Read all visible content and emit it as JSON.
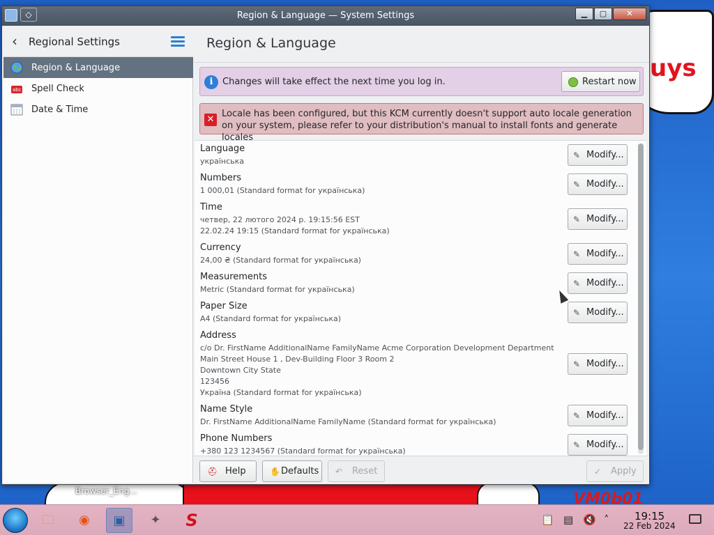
{
  "desktop": {
    "cloud_text": "uys",
    "label": "Browser_Eng...",
    "vm_label": "VM0b01"
  },
  "window": {
    "title": "Region & Language — System Settings",
    "pin_glyph": "◇",
    "min_glyph": "▁",
    "max_glyph": "▢",
    "close_glyph": "✕"
  },
  "sidebar": {
    "back_glyph": "‹",
    "title": "Regional Settings",
    "items": [
      {
        "label": "Region & Language",
        "icon": "globe-icon",
        "active": true
      },
      {
        "label": "Spell Check",
        "icon": "spell-check-icon",
        "active": false
      },
      {
        "label": "Date & Time",
        "icon": "calendar-icon",
        "active": false
      }
    ]
  },
  "main": {
    "title": "Region & Language",
    "info_message": "Changes will take effect the next time you log in.",
    "info_icon_glyph": "i",
    "restart_label": "Restart now",
    "error_icon_glyph": "✕",
    "error_message": "Locale has been configured, but this KCM currently doesn't support auto locale generation on your system, please refer to your distribution's manual to install fonts and generate locales",
    "modify_label": "Modify...",
    "modify_icon_glyph": "✎",
    "settings": [
      {
        "label": "Language",
        "sub": [
          "українська"
        ]
      },
      {
        "label": "Numbers",
        "sub": [
          "1 000,01 (Standard format for українська)"
        ]
      },
      {
        "label": "Time",
        "sub": [
          "четвер, 22 лютого 2024 р. 19:15:56 EST",
          "22.02.24 19:15 (Standard format for українська)"
        ]
      },
      {
        "label": "Currency",
        "sub": [
          "24,00 ₴ (Standard format for українська)"
        ]
      },
      {
        "label": "Measurements",
        "sub": [
          "Metric (Standard format for українська)"
        ]
      },
      {
        "label": "Paper Size",
        "sub": [
          "A4 (Standard format for українська)"
        ]
      },
      {
        "label": "Address",
        "sub": [
          "c/o Dr. FirstName AdditionalName FamilyName Acme Corporation Development Department",
          "Main Street House 1 , Dev-Building Floor 3 Room 2",
          "Downtown City State",
          "123456",
          "Україна (Standard format for українська)"
        ]
      },
      {
        "label": "Name Style",
        "sub": [
          "Dr. FirstName AdditionalName FamilyName (Standard format for українська)"
        ]
      },
      {
        "label": "Phone Numbers",
        "sub": [
          "+380 123 1234567 (Standard format for українська)"
        ]
      }
    ]
  },
  "footer": {
    "help_label": "Help",
    "help_icon_glyph": "⛑",
    "defaults_label": "Defaults",
    "defaults_icon_glyph": "✋",
    "reset_label": "Reset",
    "reset_icon_glyph": "↶",
    "apply_label": "Apply",
    "apply_icon_glyph": "✓"
  },
  "taskbar": {
    "apps": [
      {
        "name": "file-manager-icon",
        "glyph": "🗀",
        "active": false
      },
      {
        "name": "firefox-icon",
        "glyph": "◉",
        "active": false
      },
      {
        "name": "system-settings-icon",
        "glyph": "▣",
        "active": true
      },
      {
        "name": "gimp-icon",
        "glyph": "✦",
        "active": false
      },
      {
        "name": "app-s-icon",
        "glyph": "S",
        "active": false
      }
    ],
    "tray": [
      {
        "name": "clipboard-icon",
        "glyph": "📋"
      },
      {
        "name": "notifications-icon",
        "glyph": "▤"
      },
      {
        "name": "volume-muted-icon",
        "glyph": "🔇"
      },
      {
        "name": "tray-expand-icon",
        "glyph": "˄"
      }
    ],
    "clock_time": "19:15",
    "clock_date": "22 Feb 2024"
  },
  "colors": {
    "accent": "#2e7fd1",
    "sidebar_active": "#637180",
    "info_bg": "#e3cfe6",
    "error_bg": "#e0bdc1",
    "taskbar_bg": "#e4b3c3"
  }
}
